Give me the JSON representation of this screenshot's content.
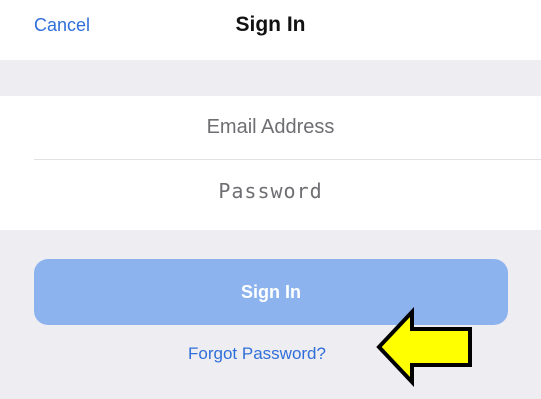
{
  "nav": {
    "cancel_label": "Cancel",
    "title": "Sign In"
  },
  "form": {
    "email_placeholder": "Email Address",
    "email_value": "",
    "password_placeholder": "Password",
    "password_value": ""
  },
  "actions": {
    "signin_label": "Sign In",
    "forgot_label": "Forgot Password?"
  },
  "annotation": {
    "arrow_icon": "left-arrow-icon",
    "arrow_color": "#ffff00"
  },
  "colors": {
    "accent": "#2f6fd9",
    "button": "#8db3ee",
    "background": "#eeedf2"
  }
}
